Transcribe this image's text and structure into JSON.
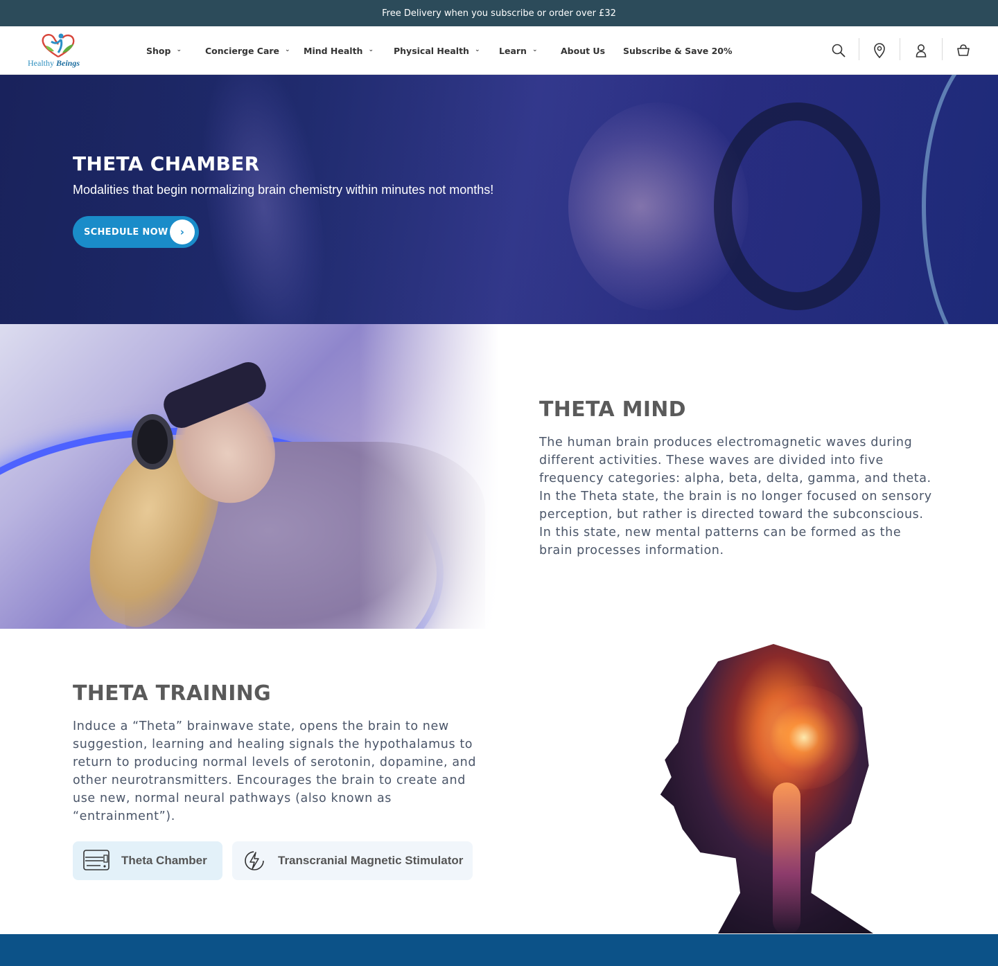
{
  "announcement": "Free Delivery when you subscribe or order over £32",
  "brand": {
    "name_part1": "Healthy",
    "name_part2": "Beings"
  },
  "nav": [
    {
      "label": "Shop",
      "has_dropdown": true
    },
    {
      "label": "Concierge Care",
      "has_dropdown": true
    },
    {
      "label": "Mind Health",
      "has_dropdown": true
    },
    {
      "label": "Physical Health",
      "has_dropdown": true
    },
    {
      "label": "Learn",
      "has_dropdown": true
    },
    {
      "label": "About Us",
      "has_dropdown": false
    },
    {
      "label": "Subscribe & Save 20%",
      "has_dropdown": false
    }
  ],
  "header_icons": [
    "search-icon",
    "location-pin-icon",
    "account-icon",
    "basket-icon"
  ],
  "hero": {
    "title": "THETA CHAMBER",
    "subtitle": "Modalities that begin normalizing brain chemistry within minutes not months!",
    "cta_label": "SCHEDULE NOW",
    "cta_color": "#1a8cc9"
  },
  "theta_mind": {
    "title": "THETA MIND",
    "body": "The human brain produces electromagnetic waves during different activities. These waves are divided into five frequency categories: alpha, beta, delta, gamma, and theta. In the Theta state, the brain is no longer focused on sensory perception, but rather is directed toward the subconscious. In this state, new mental patterns can be formed as the brain processes information."
  },
  "theta_training": {
    "title": "THETA TRAINING",
    "body": "Induce a “Theta” brainwave state, opens the brain to new suggestion, learning and healing signals the hypothalamus to return to producing normal levels of serotonin, dopamine, and other neurotransmitters. Encourages the brain to create and use new, normal neural pathways (also known as “entrainment”).",
    "chips": [
      {
        "label": "Theta Chamber",
        "icon": "chamber-device-icon",
        "active": true
      },
      {
        "label": "Transcranial Magnetic Stimulator",
        "icon": "lightning-icon",
        "active": false
      }
    ]
  },
  "colors": {
    "announcement_bg": "#2c4b5a",
    "accent": "#1a8cc9",
    "footer_band": "#0c5288",
    "heading": "#5a5a5a",
    "body_text": "#4a5568"
  }
}
